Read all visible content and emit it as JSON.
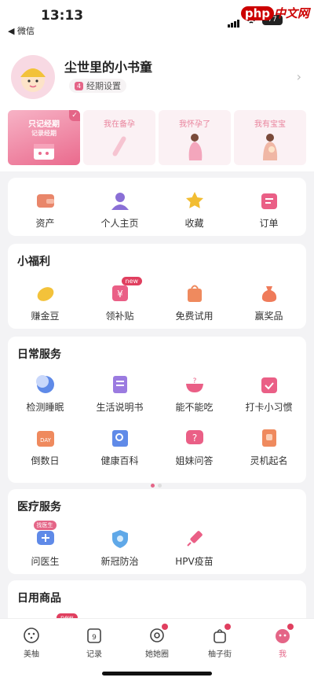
{
  "status": {
    "time": "13:13",
    "back": "◀ 微信",
    "battery": "77"
  },
  "watermark": {
    "php": "php",
    "cn": "中文网"
  },
  "user": {
    "name": "尘世里的小书童",
    "cycle": "经期设置"
  },
  "stages": [
    {
      "label": "只记经期",
      "sub": "记录经期"
    },
    {
      "label": "我在备孕"
    },
    {
      "label": "我怀孕了"
    },
    {
      "label": "我有宝宝"
    }
  ],
  "quick": [
    {
      "label": "资产",
      "color": "#e9866a"
    },
    {
      "label": "个人主页",
      "color": "#8a6fd6"
    },
    {
      "label": "收藏",
      "color": "#f2bd32"
    },
    {
      "label": "订单",
      "color": "#ea5f86"
    }
  ],
  "welfare": {
    "title": "小福利",
    "items": [
      {
        "label": "赚金豆",
        "color": "#f3c23a"
      },
      {
        "label": "领补贴",
        "color": "#ea5f86",
        "badge": "new"
      },
      {
        "label": "免费试用",
        "color": "#ef8a5e"
      },
      {
        "label": "赢奖品",
        "color": "#ef7b5a"
      }
    ]
  },
  "daily": {
    "title": "日常服务",
    "row1": [
      {
        "label": "检测睡眠",
        "color": "#5f8ae8"
      },
      {
        "label": "生活说明书",
        "color": "#9b7be0"
      },
      {
        "label": "能不能吃",
        "color": "#ea5f86"
      },
      {
        "label": "打卡小习惯",
        "color": "#ea5f86"
      }
    ],
    "row2": [
      {
        "label": "倒数日",
        "color": "#ef8a5e"
      },
      {
        "label": "健康百科",
        "color": "#5f8ae8"
      },
      {
        "label": "姐妹问答",
        "color": "#ea5f86"
      },
      {
        "label": "灵机起名",
        "color": "#ef8a5e"
      }
    ]
  },
  "medical": {
    "title": "医疗服务",
    "items": [
      {
        "label": "问医生",
        "color": "#5f8ae8",
        "badge": "找医生"
      },
      {
        "label": "新冠防治",
        "color": "#5fa8e8"
      },
      {
        "label": "HPV疫苗",
        "color": "#ea5f86"
      }
    ]
  },
  "goods": {
    "title": "日用商品",
    "badge": "new"
  },
  "tabs": [
    {
      "label": "美柚"
    },
    {
      "label": "记录",
      "num": "9"
    },
    {
      "label": "她她圈"
    },
    {
      "label": "柚子街"
    },
    {
      "label": "我"
    }
  ]
}
